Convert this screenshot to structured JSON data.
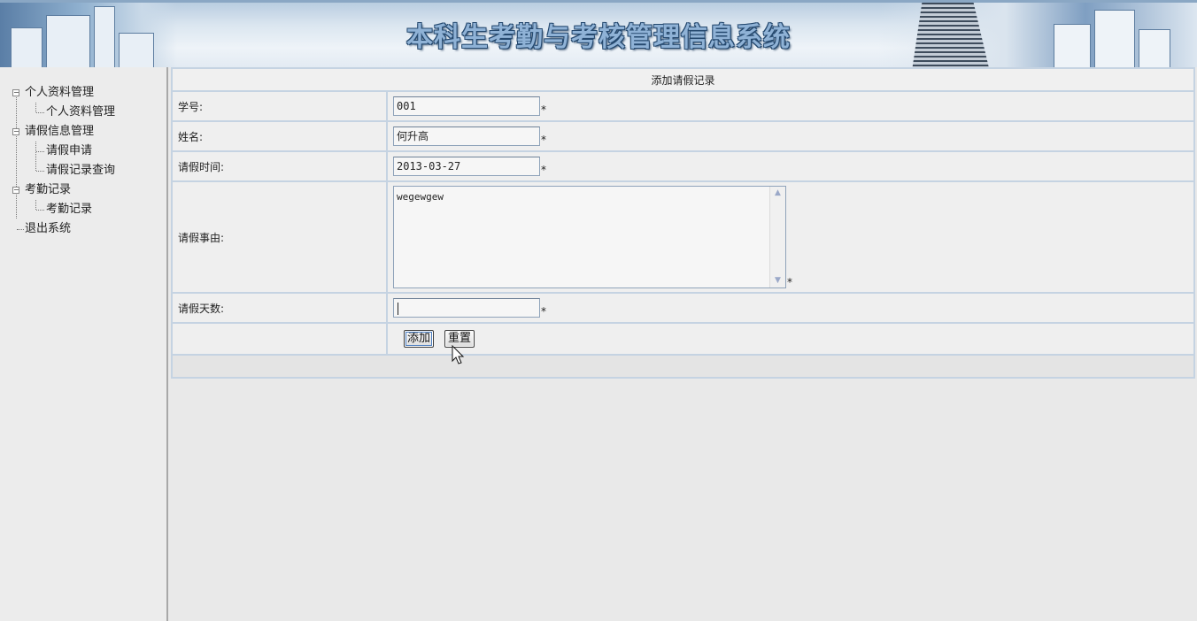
{
  "header": {
    "title": "本科生考勤与考核管理信息系统"
  },
  "sidebar": {
    "groups": [
      {
        "label": "个人资料管理",
        "children": [
          "个人资料管理"
        ]
      },
      {
        "label": "请假信息管理",
        "children": [
          "请假申请",
          "请假记录查询"
        ]
      },
      {
        "label": "考勤记录",
        "children": [
          "考勤记录"
        ]
      }
    ],
    "exit_label": "退出系统",
    "expander_symbol": "−"
  },
  "form": {
    "title": "添加请假记录",
    "required_mark": "*",
    "fields": {
      "student_id": {
        "label": "学号:",
        "value": "001"
      },
      "name": {
        "label": "姓名:",
        "value": "何升高"
      },
      "leave_date": {
        "label": "请假时间:",
        "value": "2013-03-27"
      },
      "reason": {
        "label": "请假事由:",
        "value": "wegewgew"
      },
      "days": {
        "label": "请假天数:",
        "value": ""
      }
    },
    "buttons": {
      "add": "添加",
      "reset": "重置"
    }
  },
  "icons": {
    "scroll_up": "▲",
    "scroll_down": "▼"
  }
}
